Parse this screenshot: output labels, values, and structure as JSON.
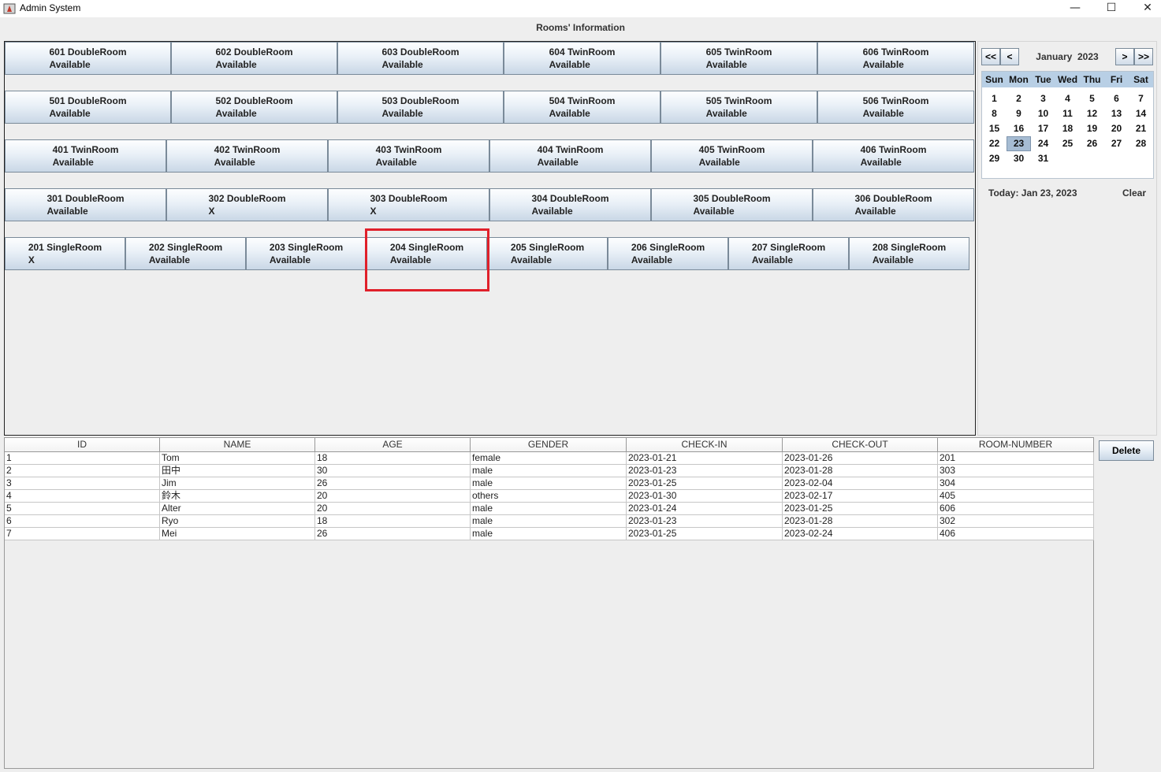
{
  "window": {
    "title": "Admin System"
  },
  "header": {
    "title": "Rooms' Information"
  },
  "rooms": {
    "rows": [
      [
        {
          "name": "601 DoubleRoom",
          "status": "Available"
        },
        {
          "name": "602 DoubleRoom",
          "status": "Available"
        },
        {
          "name": "603 DoubleRoom",
          "status": "Available"
        },
        {
          "name": "604 TwinRoom",
          "status": "Available"
        },
        {
          "name": "605 TwinRoom",
          "status": "Available"
        },
        {
          "name": "606 TwinRoom",
          "status": "Available"
        }
      ],
      [
        {
          "name": "501 DoubleRoom",
          "status": "Available"
        },
        {
          "name": "502 DoubleRoom",
          "status": "Available"
        },
        {
          "name": "503 DoubleRoom",
          "status": "Available"
        },
        {
          "name": "504 TwinRoom",
          "status": "Available"
        },
        {
          "name": "505 TwinRoom",
          "status": "Available"
        },
        {
          "name": "506 TwinRoom",
          "status": "Available"
        }
      ],
      [
        {
          "name": "401 TwinRoom",
          "status": "Available"
        },
        {
          "name": "402 TwinRoom",
          "status": "Available"
        },
        {
          "name": "403 TwinRoom",
          "status": "Available"
        },
        {
          "name": "404 TwinRoom",
          "status": "Available"
        },
        {
          "name": "405 TwinRoom",
          "status": "Available"
        },
        {
          "name": "406 TwinRoom",
          "status": "Available"
        }
      ],
      [
        {
          "name": "301 DoubleRoom",
          "status": "Available"
        },
        {
          "name": "302 DoubleRoom",
          "status": "X"
        },
        {
          "name": "303 DoubleRoom",
          "status": "X"
        },
        {
          "name": "304 DoubleRoom",
          "status": "Available"
        },
        {
          "name": "305 DoubleRoom",
          "status": "Available"
        },
        {
          "name": "306 DoubleRoom",
          "status": "Available"
        }
      ],
      [
        {
          "name": "201 SingleRoom",
          "status": "X"
        },
        {
          "name": "202 SingleRoom",
          "status": "Available"
        },
        {
          "name": "203 SingleRoom",
          "status": "Available"
        },
        {
          "name": "204 SingleRoom",
          "status": "Available"
        },
        {
          "name": "205 SingleRoom",
          "status": "Available"
        },
        {
          "name": "206 SingleRoom",
          "status": "Available"
        },
        {
          "name": "207 SingleRoom",
          "status": "Available"
        },
        {
          "name": "208 SingleRoom",
          "status": "Available"
        }
      ]
    ]
  },
  "calendar": {
    "prev_year": "<<",
    "prev_month": "<",
    "next_month": ">",
    "next_year": ">>",
    "month": "January",
    "year": "2023",
    "weekdays": [
      "Sun",
      "Mon",
      "Tue",
      "Wed",
      "Thu",
      "Fri",
      "Sat"
    ],
    "weeks": [
      [
        "1",
        "2",
        "3",
        "4",
        "5",
        "6",
        "7"
      ],
      [
        "8",
        "9",
        "10",
        "11",
        "12",
        "13",
        "14"
      ],
      [
        "15",
        "16",
        "17",
        "18",
        "19",
        "20",
        "21"
      ],
      [
        "22",
        "23",
        "24",
        "25",
        "26",
        "27",
        "28"
      ],
      [
        "29",
        "30",
        "31",
        "",
        "",
        "",
        ""
      ]
    ],
    "selected_day": "23",
    "today_label": "Today:  Jan 23, 2023",
    "clear_label": "Clear"
  },
  "table": {
    "columns": [
      "ID",
      "NAME",
      "AGE",
      "GENDER",
      "CHECK-IN",
      "CHECK-OUT",
      "ROOM-NUMBER"
    ],
    "rows": [
      [
        "1",
        "Tom",
        "18",
        "female",
        "2023-01-21",
        "2023-01-26",
        "201"
      ],
      [
        "2",
        "田中",
        "30",
        "male",
        "2023-01-23",
        "2023-01-28",
        "303"
      ],
      [
        "3",
        "Jim",
        "26",
        "male",
        "2023-01-25",
        "2023-02-04",
        "304"
      ],
      [
        "4",
        "鈴木",
        "20",
        "others",
        "2023-01-30",
        "2023-02-17",
        "405"
      ],
      [
        "5",
        "Alter",
        "20",
        "male",
        "2023-01-24",
        "2023-01-25",
        "606"
      ],
      [
        "6",
        "Ryo",
        "18",
        "male",
        "2023-01-23",
        "2023-01-28",
        "302"
      ],
      [
        "7",
        "Mei",
        "26",
        "male",
        "2023-01-25",
        "2023-02-24",
        "406"
      ]
    ]
  },
  "actions": {
    "delete_label": "Delete"
  }
}
